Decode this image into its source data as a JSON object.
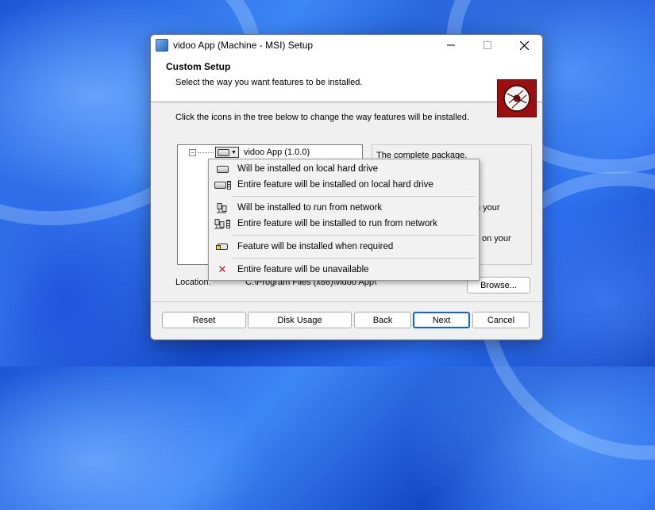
{
  "window": {
    "title": "vidoo App (Machine - MSI) Setup",
    "controls": [
      "minimize",
      "maximize",
      "close"
    ]
  },
  "header": {
    "title": "Custom Setup",
    "subtitle": "Select the way you want features to be installed."
  },
  "instructions": "Click the icons in the tree below to change the way features will be installed.",
  "tree": {
    "expander": "⊟",
    "node_label": "vidoo App (1.0.0)"
  },
  "description": {
    "text": "The complete package.",
    "fragment1": "n your",
    "fragment2": "on your"
  },
  "location": {
    "label": "Location:",
    "value": "C:\\Program Files (x86)\\vidoo App\\"
  },
  "buttons": {
    "browse": "Browse...",
    "reset": "Reset",
    "disk_usage": "Disk Usage",
    "back": "Back",
    "next": "Next",
    "cancel": "Cancel"
  },
  "context_menu": {
    "items": [
      {
        "label": "Will be installed on local hard drive",
        "icon": "hard-drive-icon"
      },
      {
        "label": "Entire feature will be installed on local hard drive",
        "icon": "hard-drive-stack-icon"
      },
      {
        "label": "Will be installed to run from network",
        "icon": "network-icon"
      },
      {
        "label": "Entire feature will be installed to run from network",
        "icon": "network-stack-icon"
      },
      {
        "label": "Feature will be installed when required",
        "icon": "on-demand-icon"
      },
      {
        "label": "Entire feature will be unavailable",
        "icon": "unavailable-x-icon"
      }
    ]
  },
  "colors": {
    "banner": "#9a0f0f",
    "primary_border": "#0a64d4",
    "unavailable": "#c01818"
  }
}
